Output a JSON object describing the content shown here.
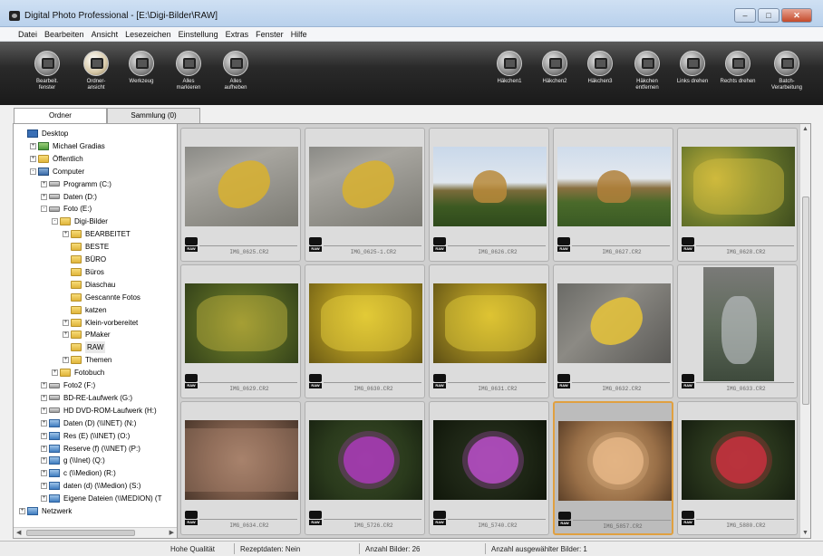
{
  "window": {
    "title": "Digital Photo Professional - [E:\\Digi-Bilder\\RAW]",
    "controls": [
      "–",
      "□",
      "✕"
    ]
  },
  "menu": [
    "Datei",
    "Bearbeiten",
    "Ansicht",
    "Lesezeichen",
    "Einstellung",
    "Extras",
    "Fenster",
    "Hilfe"
  ],
  "toolbar": {
    "left": [
      {
        "label": "Bearbeit.\nfenster",
        "icon": "edit-window-icon"
      },
      {
        "label": "Ordner-\nansicht",
        "icon": "folder-view-icon",
        "active": true
      },
      {
        "label": "Werkzeug",
        "icon": "tool-palette-icon"
      },
      {
        "label": "Alles\nmarkieren",
        "icon": "select-all-icon"
      },
      {
        "label": "Alles\naufheben",
        "icon": "clear-all-icon"
      }
    ],
    "right": [
      {
        "label": "Häkchen1",
        "icon": "check-mark-1-icon"
      },
      {
        "label": "Häkchen2",
        "icon": "check-mark-2-icon"
      },
      {
        "label": "Häkchen3",
        "icon": "check-mark-3-icon"
      },
      {
        "label": "Häkchen\nentfernen",
        "icon": "remove-check-icon"
      },
      {
        "label": "Links drehen",
        "icon": "rotate-left-icon"
      },
      {
        "label": "Rechts drehen",
        "icon": "rotate-right-icon"
      },
      {
        "label": "Batch-\nVerarbeitung",
        "icon": "batch-process-icon"
      }
    ]
  },
  "tabs": [
    "Ordner",
    "Sammlung (0)"
  ],
  "tree": [
    {
      "label": "Desktop",
      "icon": "desktop",
      "level": 0,
      "exp": ""
    },
    {
      "label": "Michael Gradias",
      "icon": "user",
      "level": 1,
      "exp": "+"
    },
    {
      "label": "Öffentlich",
      "icon": "folder",
      "level": 1,
      "exp": "+"
    },
    {
      "label": "Computer",
      "icon": "computer",
      "level": 1,
      "exp": "-"
    },
    {
      "label": "Programm (C:)",
      "icon": "drive",
      "level": 2,
      "exp": "+"
    },
    {
      "label": "Daten (D:)",
      "icon": "drive",
      "level": 2,
      "exp": "+"
    },
    {
      "label": "Foto (E:)",
      "icon": "drive",
      "level": 2,
      "exp": "-"
    },
    {
      "label": "Digi-Bilder",
      "icon": "folder",
      "level": 3,
      "exp": "-"
    },
    {
      "label": "BEARBEITET",
      "icon": "folder",
      "level": 4,
      "exp": "+"
    },
    {
      "label": "BESTE",
      "icon": "folder",
      "level": 4,
      "exp": ""
    },
    {
      "label": "BÜRO",
      "icon": "folder",
      "level": 4,
      "exp": ""
    },
    {
      "label": "Büros",
      "icon": "folder",
      "level": 4,
      "exp": ""
    },
    {
      "label": "Diaschau",
      "icon": "folder",
      "level": 4,
      "exp": ""
    },
    {
      "label": "Gescannte Fotos",
      "icon": "folder",
      "level": 4,
      "exp": ""
    },
    {
      "label": "katzen",
      "icon": "folder",
      "level": 4,
      "exp": ""
    },
    {
      "label": "Klein-vorbereitet",
      "icon": "folder",
      "level": 4,
      "exp": "+"
    },
    {
      "label": "PMaker",
      "icon": "folder",
      "level": 4,
      "exp": "+"
    },
    {
      "label": "RAW",
      "icon": "folder",
      "level": 4,
      "exp": ""
    },
    {
      "label": "Themen",
      "icon": "folder",
      "level": 4,
      "exp": "+"
    },
    {
      "label": "Fotobuch",
      "icon": "folder",
      "level": 3,
      "exp": "+"
    },
    {
      "label": "Foto2 (F:)",
      "icon": "drive",
      "level": 2,
      "exp": "+"
    },
    {
      "label": "BD-RE-Laufwerk (G:)",
      "icon": "drive",
      "level": 2,
      "exp": "+"
    },
    {
      "label": "HD DVD-ROM-Laufwerk (H:)",
      "icon": "drive",
      "level": 2,
      "exp": "+"
    },
    {
      "label": "Daten (D) (\\\\INET) (N:)",
      "icon": "net",
      "level": 2,
      "exp": "+"
    },
    {
      "label": "Res (E) (\\\\INET) (O:)",
      "icon": "net",
      "level": 2,
      "exp": "+"
    },
    {
      "label": "Reserve (f) (\\\\INET) (P:)",
      "icon": "net",
      "level": 2,
      "exp": "+"
    },
    {
      "label": "g (\\\\Inet) (Q:)",
      "icon": "net",
      "level": 2,
      "exp": "+"
    },
    {
      "label": "c (\\\\Medion) (R:)",
      "icon": "net",
      "level": 2,
      "exp": "+"
    },
    {
      "label": "daten (d) (\\\\Medion) (S:)",
      "icon": "net",
      "level": 2,
      "exp": "+"
    },
    {
      "label": "Eigene Dateien (\\\\MEDION) (T",
      "icon": "net",
      "level": 2,
      "exp": "+"
    },
    {
      "label": "Netzwerk",
      "icon": "net",
      "level": 0,
      "exp": "+"
    }
  ],
  "thumbnails": [
    {
      "name": "IMG_0625.CR2",
      "bg": "linear-gradient(160deg,#8a8a86 0%,#a7a59f 30%,#7b7a73 100%)",
      "accent": "#d9b22e",
      "kind": "leaf-on-paving"
    },
    {
      "name": "IMG_0625-1.CR2",
      "bg": "linear-gradient(160deg,#8a8a86 0%,#a7a59f 30%,#7b7a73 100%)",
      "accent": "#d9b22e",
      "kind": "leaf-on-paving"
    },
    {
      "name": "IMG_0626.CR2",
      "bg": "linear-gradient(#c9d8ea 0%,#dfe6ee 45%,#7a6b3a 55%,#3d5a22 75%,#2f4a1c 100%)",
      "accent": "#b88a3a",
      "kind": "landscape"
    },
    {
      "name": "IMG_0627.CR2",
      "bg": "linear-gradient(#cfdcec 0%,#e3e8ee 40%,#8a7040 52%,#4a6a2a 70%,#3a5a24 100%)",
      "accent": "#b0803a",
      "kind": "landscape"
    },
    {
      "name": "IMG_0628.CR2",
      "bg": "radial-gradient(circle at 30% 40%,#c9b43a,#6c7a2c 50%,#3e4c1e 100%)",
      "accent": "#d8c040",
      "kind": "leaves"
    },
    {
      "name": "IMG_0629.CR2",
      "bg": "radial-gradient(circle at 50% 50%,#8a8a2c,#556422 50%,#34421a 100%)",
      "accent": "#c8b840",
      "kind": "leaves"
    },
    {
      "name": "IMG_0630.CR2",
      "bg": "radial-gradient(circle at 50% 40%,#d8c030,#a89020 50%,#6a5a14 100%)",
      "accent": "#f0d840",
      "kind": "leaves"
    },
    {
      "name": "IMG_0631.CR2",
      "bg": "radial-gradient(circle at 50% 40%,#d4b62c,#9a8420 50%,#5c4e14 100%)",
      "accent": "#ecd43c",
      "kind": "leaves"
    },
    {
      "name": "IMG_0632.CR2",
      "bg": "linear-gradient(135deg,#6a6a66 0%,#8c8a84 40%,#5a5956 100%)",
      "accent": "#e8c438",
      "kind": "leaf-on-gravel"
    },
    {
      "name": "IMG_0633.CR2",
      "bg": "linear-gradient(#7a7a78 0%,#5e6a5a 50%,#3e4a3c 100%)",
      "accent": "#c8ccd0",
      "kind": "plant-portrait"
    },
    {
      "name": "IMG_0634.CR2",
      "bg": "radial-gradient(circle at 50% 50%,#a07c66,#7c5c4a 50%,#4c382c 100%)",
      "accent": "#b89078",
      "kind": "heather"
    },
    {
      "name": "IMG_5726.CR2",
      "bg": "radial-gradient(circle at 50% 50%,#3a4a28,#2a3a1c 60%,#1a2412 100%)",
      "accent": "#b03ac0",
      "kind": "purple-flowers"
    },
    {
      "name": "IMG_5740.CR2",
      "bg": "radial-gradient(circle at 50% 50%,#2a3420,#1c2414 60%,#10160a 100%)",
      "accent": "#c050d0",
      "kind": "purple-flower"
    },
    {
      "name": "IMG_5857.CR2",
      "bg": "radial-gradient(circle at 50% 50%,#c8a070,#9a7048 60%,#5c4028 100%)",
      "accent": "#e8b888",
      "kind": "orange-flowers"
    },
    {
      "name": "IMG_5880.CR2",
      "bg": "radial-gradient(circle at 50% 50%,#3a4a2a,#26321a 60%,#161e10 100%)",
      "accent": "#d03040",
      "kind": "red-flowers"
    }
  ],
  "selected_index": 13,
  "raw_badge": "RAW",
  "status": {
    "quality": "Hohe Qualität",
    "recipe": "Rezeptdaten: Nein",
    "count": "Anzahl Bilder: 26",
    "selected": "Anzahl ausgewählter Bilder: 1"
  }
}
